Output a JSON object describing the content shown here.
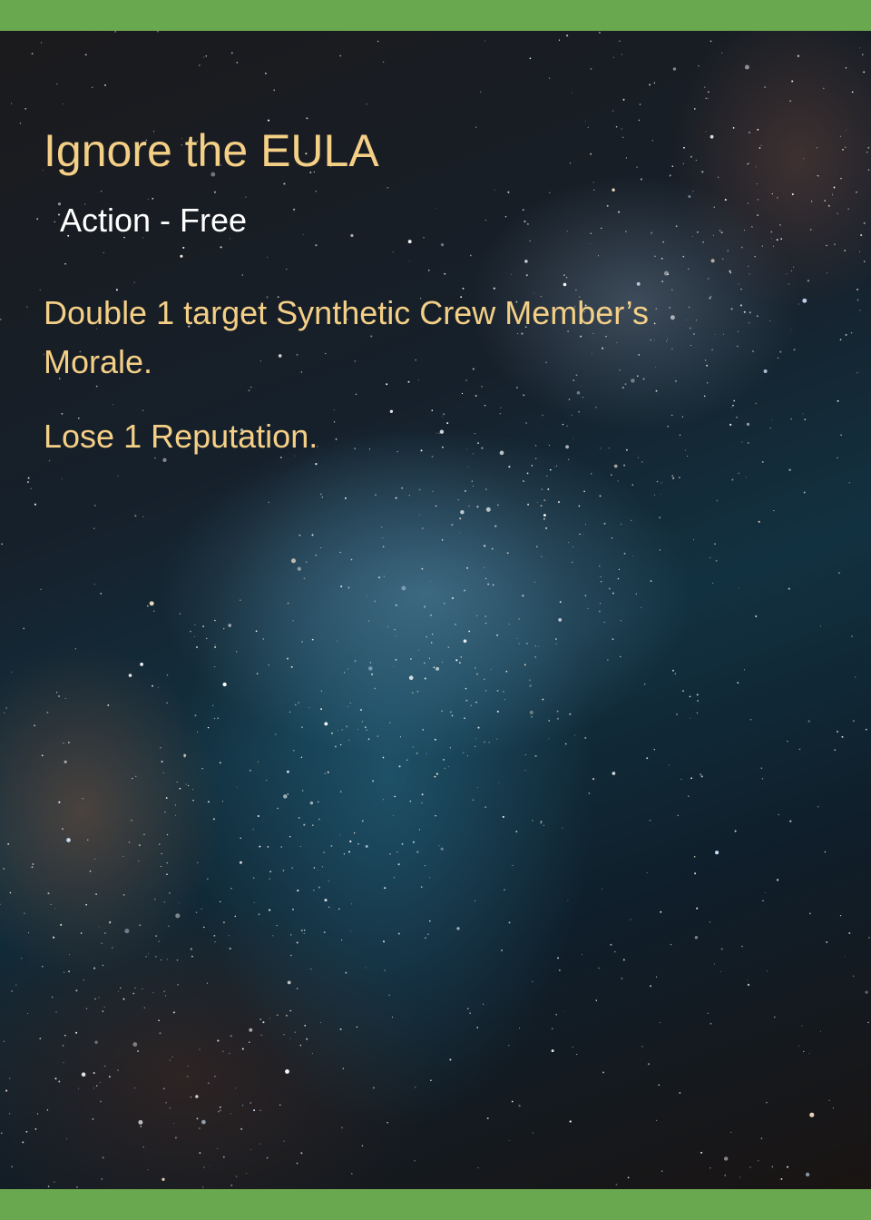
{
  "card": {
    "title": "Ignore the EULA",
    "type_line": "Action - Free",
    "rules_text": [
      "Double 1 target Synthetic Crew Member’s Morale.",
      "Lose 1 Reputation."
    ]
  },
  "colors": {
    "border_green": "#6aa84f",
    "title_gold": "#f4cf86",
    "type_white": "#ffffff"
  }
}
